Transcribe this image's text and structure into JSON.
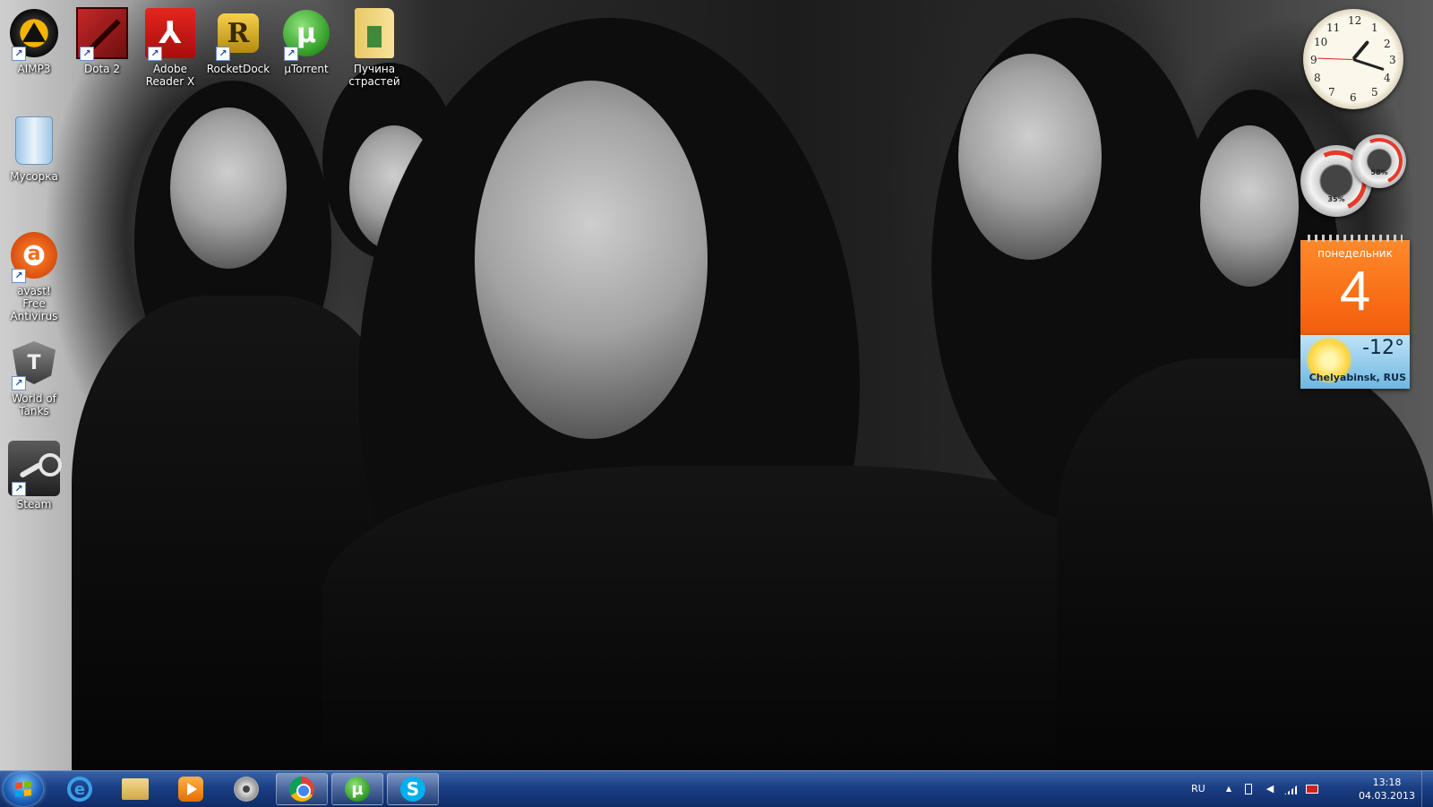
{
  "desktop": {
    "icons": [
      {
        "label": "AIMP3",
        "icon": "aimp-icon",
        "shortcut": true
      },
      {
        "label": "Dota 2",
        "icon": "dota2-icon",
        "shortcut": true
      },
      {
        "label": "Adobe Reader X",
        "icon": "adobe-reader-icon",
        "shortcut": true
      },
      {
        "label": "RocketDock",
        "icon": "rocketdock-icon",
        "shortcut": true
      },
      {
        "label": "µTorrent",
        "icon": "utorrent-icon",
        "shortcut": true
      },
      {
        "label": "Пучина страстей",
        "icon": "folder-icon",
        "shortcut": false
      },
      {
        "label": "Мусорка",
        "icon": "recycle-bin-icon",
        "shortcut": false
      },
      {
        "label": "avast! Free Antivirus",
        "icon": "avast-icon",
        "shortcut": true
      },
      {
        "label": "World of Tanks",
        "icon": "world-of-tanks-icon",
        "shortcut": true
      },
      {
        "label": "Steam",
        "icon": "steam-icon",
        "shortcut": true
      }
    ],
    "shortcut_glyph": "↗"
  },
  "gadgets": {
    "clock": {
      "numbers": [
        "12",
        "1",
        "2",
        "3",
        "4",
        "5",
        "6",
        "7",
        "8",
        "9",
        "10",
        "11"
      ]
    },
    "cpu_meter": {
      "cpu_percent": "35%",
      "memory_percent": "58%"
    },
    "calendar": {
      "day_of_week": "понедельник",
      "day": "4"
    },
    "weather": {
      "temperature": "-12°",
      "location": "Chelyabinsk, RUS"
    }
  },
  "taskbar": {
    "start_glyph": "",
    "ie_glyph": "e",
    "utorrent_glyph": "µ",
    "skype_glyph": "S",
    "pinned": [
      {
        "name": "internet-explorer",
        "active": false
      },
      {
        "name": "windows-explorer",
        "active": false
      },
      {
        "name": "media-player",
        "active": false
      },
      {
        "name": "disc-app",
        "active": false
      },
      {
        "name": "google-chrome",
        "active": true
      },
      {
        "name": "utorrent",
        "active": true
      },
      {
        "name": "skype",
        "active": true
      }
    ],
    "tray": {
      "language": "RU",
      "show_hidden_glyph": "▲",
      "time": "13:18",
      "date": "04.03.2013"
    }
  },
  "colors": {
    "taskbar": "#1b3f84",
    "calendar": "#f25b09",
    "weather": "#6fb7e0"
  }
}
